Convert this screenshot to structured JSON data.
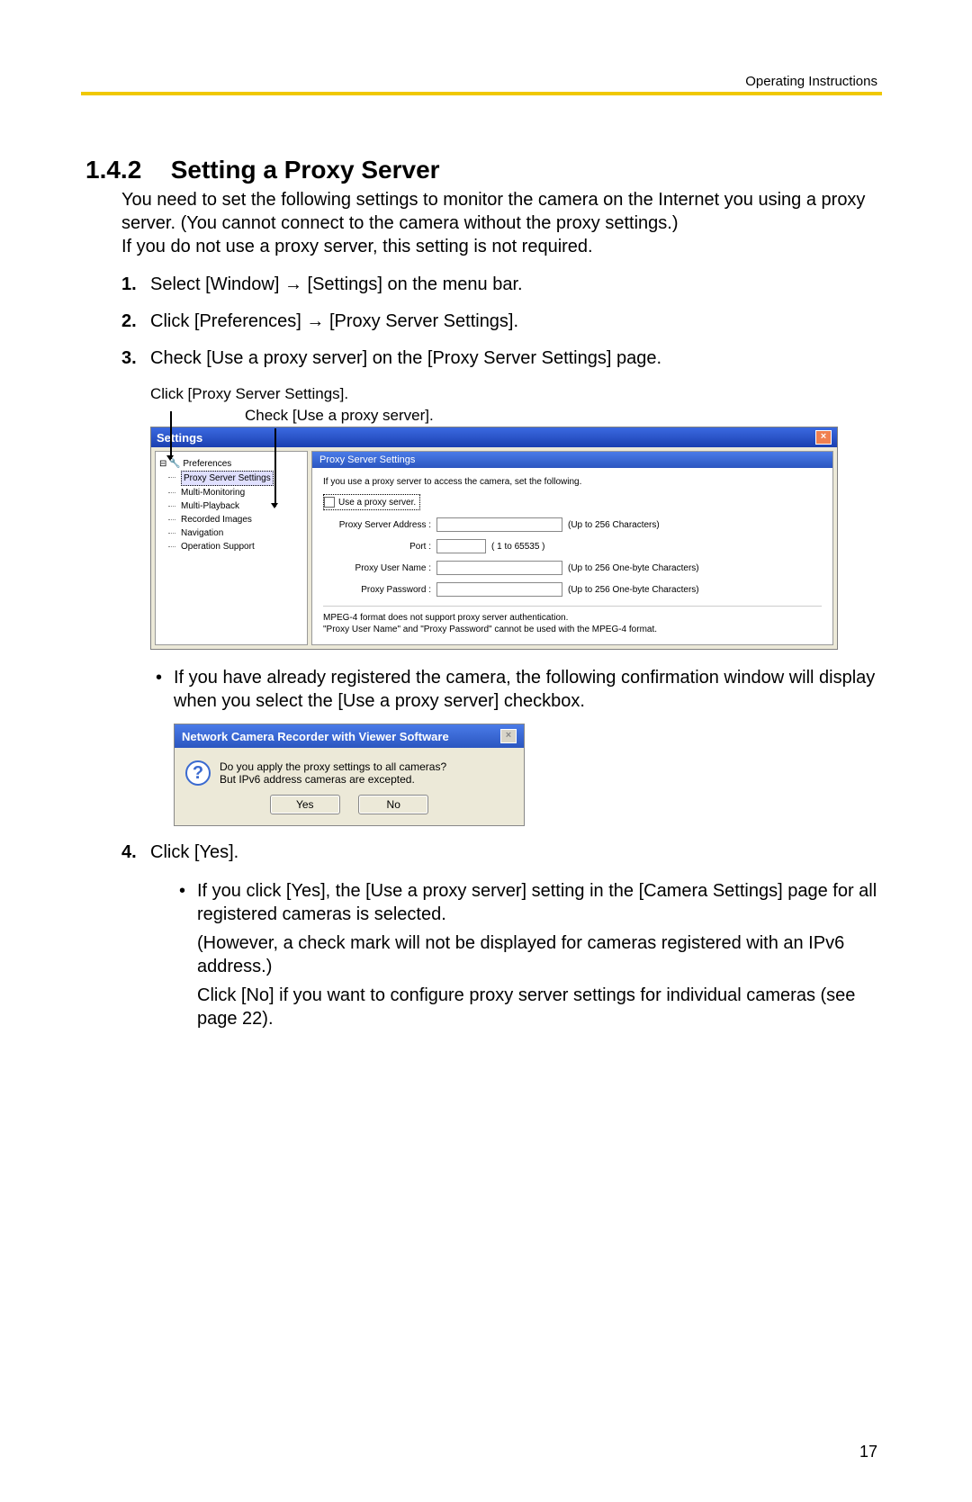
{
  "header": {
    "right": "Operating Instructions"
  },
  "section": {
    "number": "1.4.2",
    "title": "Setting a Proxy Server"
  },
  "intro": {
    "p1": "You need to set the following settings to monitor the camera on the Internet you using a proxy server. (You cannot connect to the camera without the proxy settings.)",
    "p2": "If you do not use a proxy server, this setting is not required."
  },
  "steps": {
    "s1_a": "Select [Window]",
    "s1_b": "[Settings] on the menu bar.",
    "s2_a": "Click [Preferences]",
    "s2_b": "[Proxy Server Settings].",
    "s3": "Check [Use a proxy server] on the [Proxy Server Settings] page.",
    "s4": "Click [Yes]."
  },
  "callouts": {
    "c1": "Click [Proxy Server Settings].",
    "c2": "Check [Use a proxy server]."
  },
  "settings_win": {
    "title": "Settings",
    "tree": {
      "root": "Preferences",
      "items": [
        "Proxy Server Settings",
        "Multi-Monitoring",
        "Multi-Playback",
        "Recorded Images",
        "Navigation",
        "Operation Support"
      ]
    },
    "pane_title": "Proxy Server Settings",
    "instruction": "If you use a proxy server to access the camera, set the following.",
    "checkbox": "Use a proxy server.",
    "fields": {
      "addr": {
        "label": "Proxy Server Address :",
        "hint": "(Up to 256 Characters)"
      },
      "port": {
        "label": "Port :",
        "hint": "( 1 to 65535 )"
      },
      "user": {
        "label": "Proxy User Name :",
        "hint": "(Up to 256 One-byte Characters)"
      },
      "pass": {
        "label": "Proxy Password :",
        "hint": "(Up to 256 One-byte Characters)"
      }
    },
    "footnote1": "MPEG-4 format does not support proxy server authentication.",
    "footnote2": "\"Proxy User Name\" and \"Proxy Password\" cannot be used with the MPEG-4 format."
  },
  "bullet1": "If you have already registered the camera, the following confirmation window will display when you select the [Use a proxy server] checkbox.",
  "dialog": {
    "title": "Network Camera Recorder with Viewer Software",
    "line1": "Do you apply the proxy settings to all cameras?",
    "line2": "But IPv6 address cameras are excepted.",
    "yes": "Yes",
    "no": "No"
  },
  "step4_sub": {
    "b1": "If you click [Yes], the [Use a proxy server] setting in the [Camera Settings] page for all registered cameras is selected.",
    "p1": "(However, a check mark will not be displayed for cameras registered with an IPv6 address.)",
    "p2": "Click [No] if you want to configure proxy server settings for individual cameras (see page 22)."
  },
  "page_number": "17"
}
